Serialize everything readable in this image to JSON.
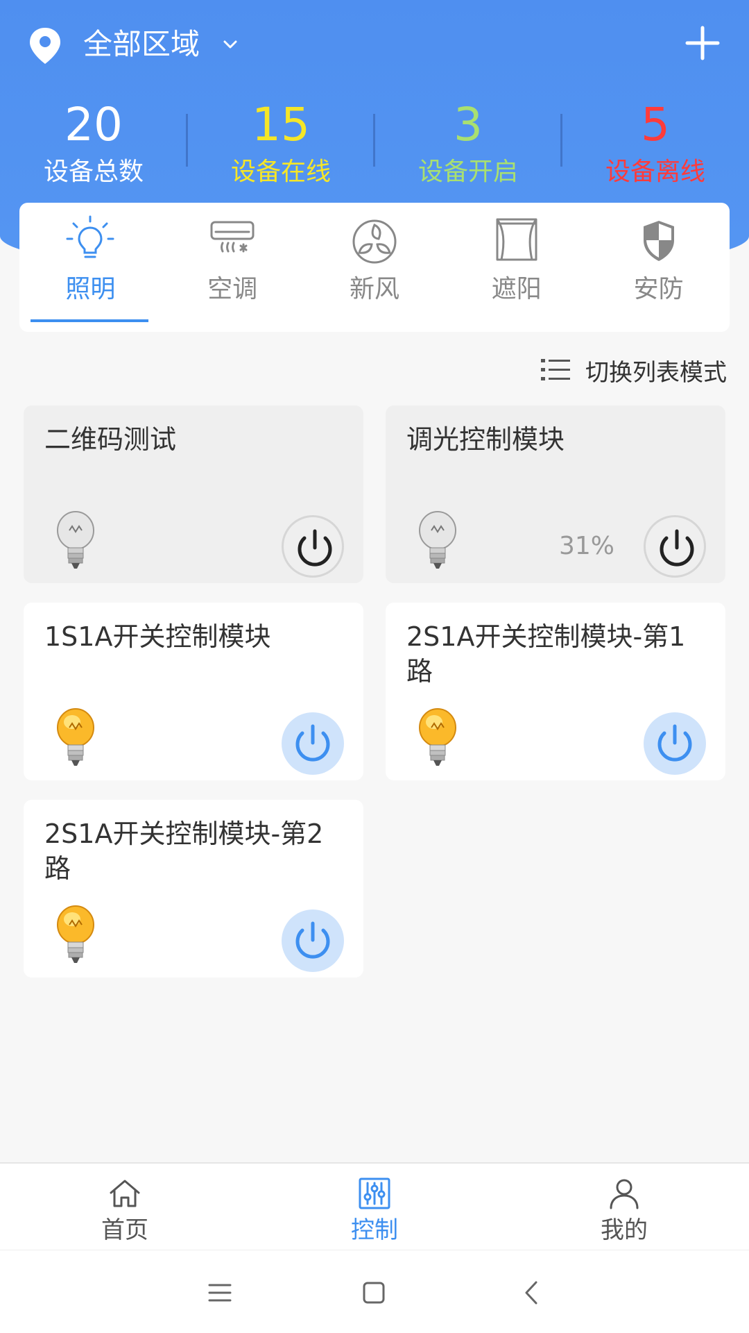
{
  "header": {
    "region_label": "全部区域",
    "colors": {
      "gradient_top": "#4f8ff0",
      "online": "#f5e628",
      "on": "#a9e070",
      "offline": "#ff3b3b",
      "total": "#ffffff"
    }
  },
  "stats": [
    {
      "value": "20",
      "label": "设备总数",
      "color": "#ffffff"
    },
    {
      "value": "15",
      "label": "设备在线",
      "color": "#f5e628"
    },
    {
      "value": "3",
      "label": "设备开启",
      "color": "#a9e070"
    },
    {
      "value": "5",
      "label": "设备离线",
      "color": "#ff3b3b"
    }
  ],
  "tabs": [
    {
      "label": "照明",
      "icon": "bulb-outline-icon",
      "active": true
    },
    {
      "label": "空调",
      "icon": "air-conditioner-icon",
      "active": false
    },
    {
      "label": "新风",
      "icon": "fresh-air-icon",
      "active": false
    },
    {
      "label": "遮阳",
      "icon": "curtain-icon",
      "active": false
    },
    {
      "label": "安防",
      "icon": "shield-icon",
      "active": false
    }
  ],
  "switch_mode": {
    "label": "切换列表模式",
    "icon": "list-icon"
  },
  "devices": [
    {
      "name": "二维码测试",
      "state": "off",
      "percent": ""
    },
    {
      "name": "调光控制模块",
      "state": "off",
      "percent": "31%"
    },
    {
      "name": "1S1A开关控制模块",
      "state": "on",
      "percent": ""
    },
    {
      "name": "2S1A开关控制模块-第1路",
      "state": "on",
      "percent": ""
    },
    {
      "name": "2S1A开关控制模块-第2路",
      "state": "on",
      "percent": ""
    }
  ],
  "bottom_nav": [
    {
      "label": "首页",
      "icon": "home-icon",
      "active": false
    },
    {
      "label": "控制",
      "icon": "sliders-icon",
      "active": true
    },
    {
      "label": "我的",
      "icon": "user-icon",
      "active": false
    }
  ],
  "system_bar": {
    "icons": [
      "menu-icon",
      "home-square-icon",
      "back-icon"
    ]
  }
}
